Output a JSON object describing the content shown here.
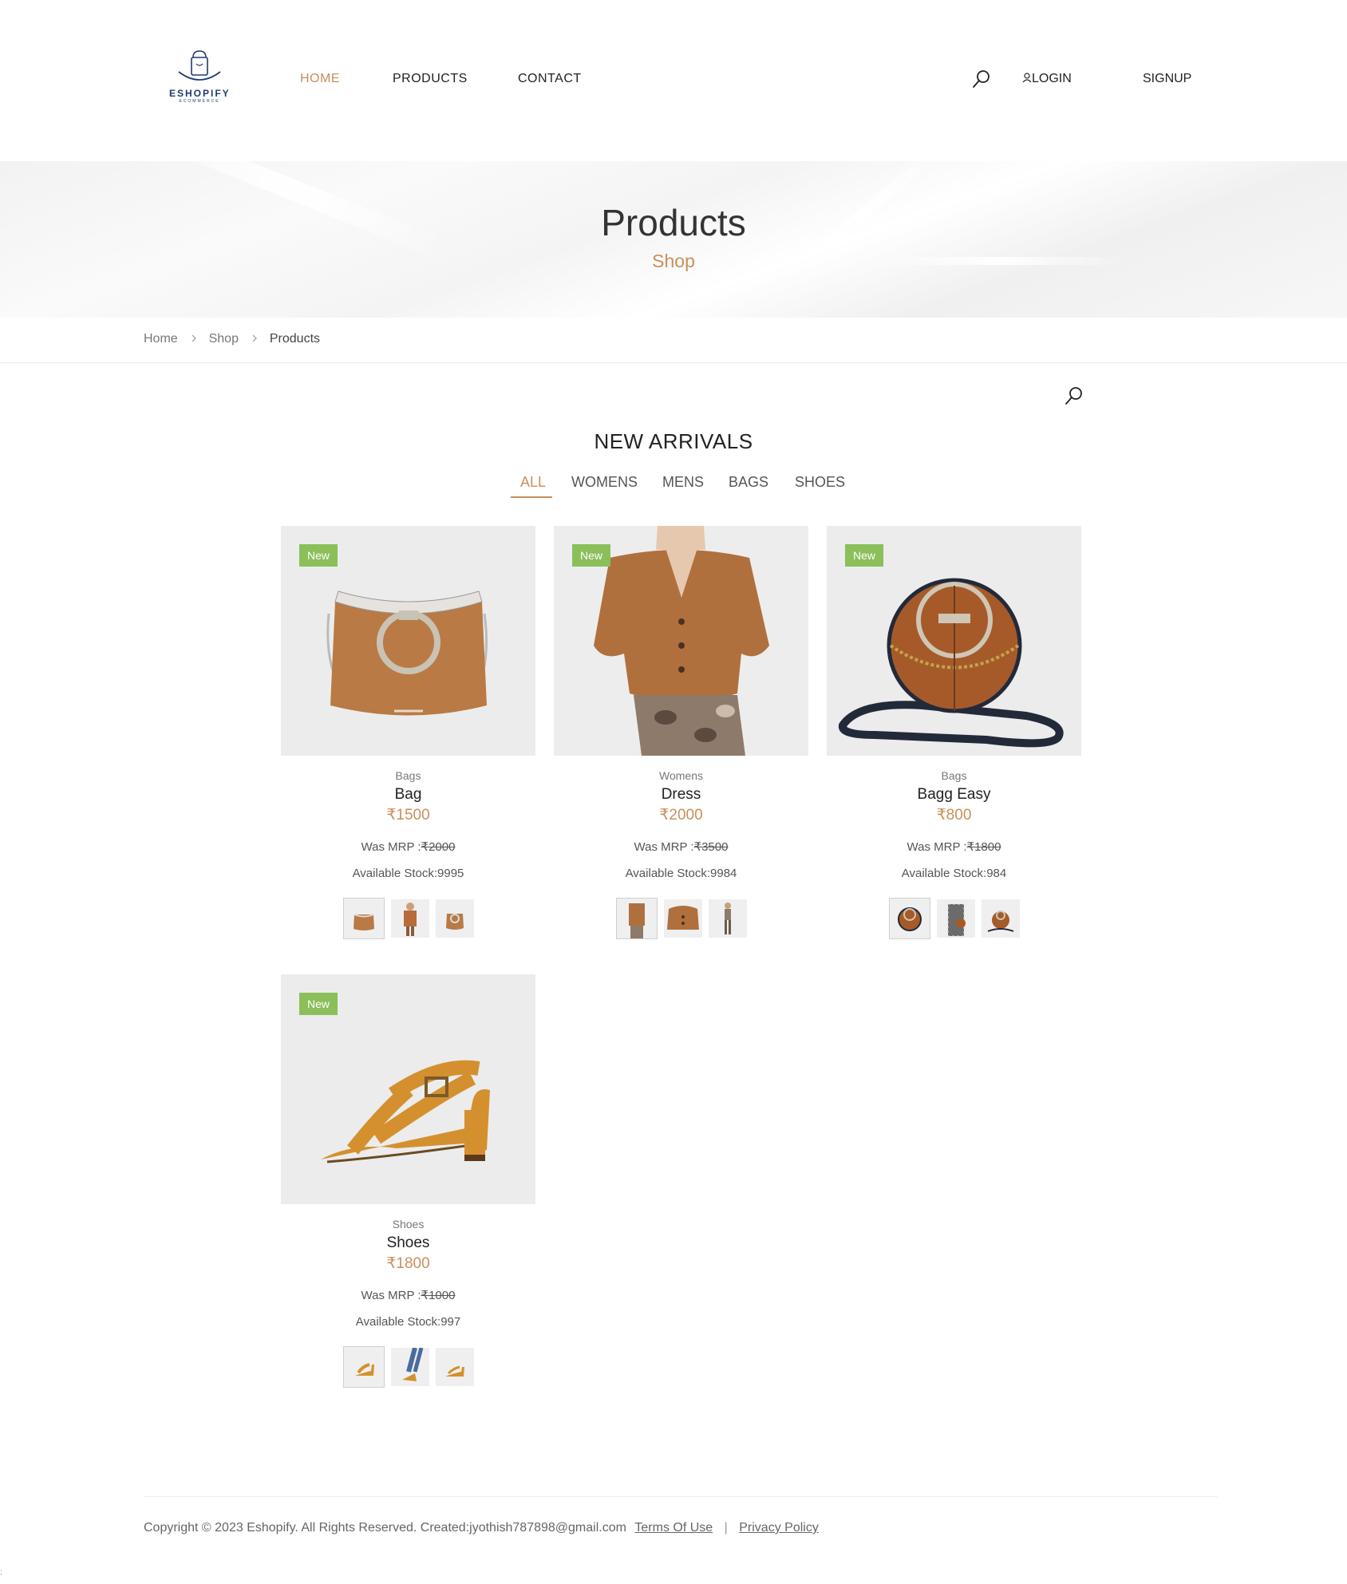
{
  "header": {
    "logo_text": "ESHOPIFY",
    "logo_sub": "ECOMMERCE",
    "nav": [
      {
        "label": "HOME",
        "active": true
      },
      {
        "label": "PRODUCTS",
        "active": false
      },
      {
        "label": "CONTACT",
        "active": false
      }
    ],
    "login_label": "LOGIN",
    "signup_label": "SIGNUP"
  },
  "banner": {
    "title": "Products",
    "subtitle": "Shop"
  },
  "breadcrumb": [
    "Home",
    "Shop",
    "Products"
  ],
  "section": {
    "title": "NEW ARRIVALS",
    "filters": [
      "ALL",
      "WOMENS",
      "MENS",
      "BAGS",
      "SHOES"
    ],
    "active_filter": "ALL"
  },
  "products": [
    {
      "badge": "New",
      "category": "Bags",
      "name": "Bag",
      "price": "₹1500",
      "was_label": "Was MRP :",
      "was_price": "₹2000",
      "stock": "Available Stock:9995",
      "image": "tan-handbag"
    },
    {
      "badge": "New",
      "category": "Womens",
      "name": "Dress",
      "price": "₹2000",
      "was_label": "Was MRP :",
      "was_price": "₹3500",
      "stock": "Available Stock:9984",
      "image": "brown-cardigan"
    },
    {
      "badge": "New",
      "category": "Bags",
      "name": "Bagg Easy",
      "price": "₹800",
      "was_label": "Was MRP :",
      "was_price": "₹1800",
      "stock": "Available Stock:984",
      "image": "round-crossbody-bag"
    },
    {
      "badge": "New",
      "category": "Shoes",
      "name": "Shoes",
      "price": "₹1800",
      "was_label": "Was MRP :",
      "was_price": "₹1000",
      "stock": "Available Stock:997",
      "image": "mustard-heeled-sandal"
    }
  ],
  "footer": {
    "copyright": "Copyright © 2023 Eshopify. All Rights Reserved. Created:jyothish787898@gmail.com",
    "terms": "Terms Of Use",
    "separator": "|",
    "privacy": "Privacy Policy"
  },
  "stray_mark": ";",
  "colors": {
    "accent": "#c8905a",
    "badge": "#8bbf5a",
    "logo": "#1f3a6e"
  }
}
